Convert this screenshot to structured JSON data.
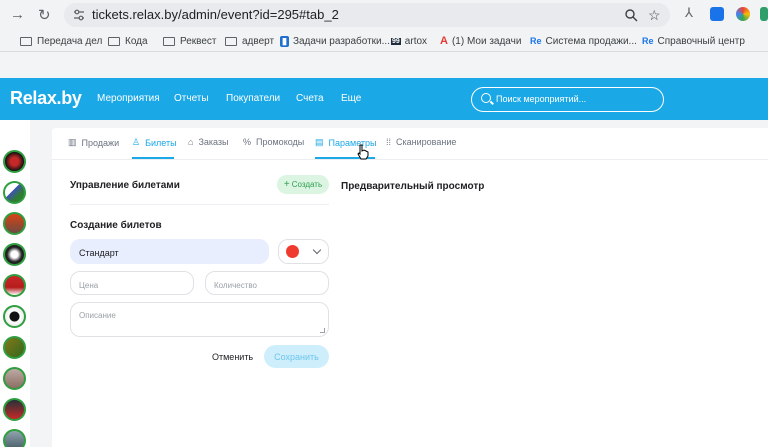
{
  "browser": {
    "url": "tickets.relax.by/admin/event?id=295#tab_2",
    "bookmarks": [
      {
        "label": "Передача дел",
        "icon": "folder-icon"
      },
      {
        "label": "Кода",
        "icon": "folder-icon"
      },
      {
        "label": "Реквест",
        "icon": "folder-icon"
      },
      {
        "label": "адверт",
        "icon": "folder-icon"
      },
      {
        "label": "Задачи разработки...",
        "icon": "trello-icon"
      },
      {
        "label": "artox",
        "icon": "artox-icon"
      },
      {
        "label": "(1) Мои задачи",
        "icon": "app-icon"
      },
      {
        "label": "Система продажи...",
        "icon": "re-icon"
      },
      {
        "label": "Справочный центр",
        "icon": "re-icon"
      }
    ],
    "artox_badge": "99"
  },
  "app": {
    "logo": "Relax.by",
    "menu": [
      "Мероприятия",
      "Отчеты",
      "Покупатели",
      "Счета",
      "Еще"
    ],
    "search_placeholder": "Поиск мероприятий..."
  },
  "tabs": [
    {
      "label": "Продажи",
      "icon": "chart-icon"
    },
    {
      "label": "Билеты",
      "icon": "person-icon",
      "active": true
    },
    {
      "label": "Заказы",
      "icon": "basket-icon"
    },
    {
      "label": "Промокоды",
      "icon": "percent-icon"
    },
    {
      "label": "Параметры",
      "icon": "clipboard-icon",
      "hovered": true
    },
    {
      "label": "Сканирование",
      "icon": "grid-icon"
    }
  ],
  "tickets": {
    "title": "Управление билетами",
    "add_label": "Создать",
    "create_title": "Создание билетов",
    "name_value": "Стандарт",
    "selected_color": "#ef3b2f",
    "price_placeholder": "Цена",
    "qty_placeholder": "Количество",
    "desc_placeholder": "Описание",
    "cancel_label": "Отменить",
    "save_label": "Сохранить"
  },
  "preview": {
    "title": "Предварительный просмотр"
  },
  "colors": {
    "accent": "#1ba8e6",
    "success": "#2e9e4f"
  }
}
